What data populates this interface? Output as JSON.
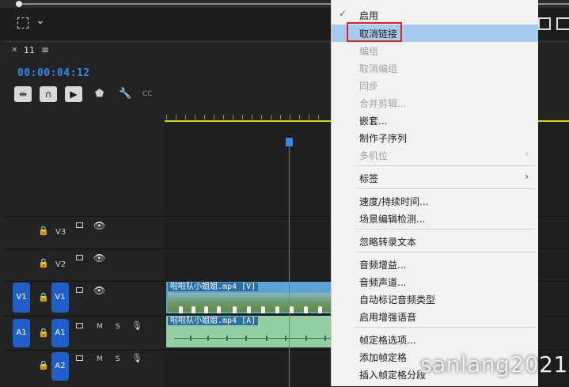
{
  "timeline": {
    "sequence_name": "11",
    "timecode": "00:00:04:12",
    "tracks": {
      "v3": "V3",
      "v2": "V2",
      "v1": "V1",
      "v1_source": "V1",
      "a1": "A1",
      "a1_source": "A1",
      "a2": "A2",
      "m_label": "M",
      "s_label": "S"
    },
    "video_clip_title": "啦啦队小姐姐.mp4 [V]",
    "audio_clip_title": "啦啦队小姐姐.mp4 [A]",
    "tool_cc": "CC"
  },
  "context_menu": {
    "items": [
      {
        "label": "启用",
        "checked": true,
        "disabled": false
      },
      {
        "label": "取消链接",
        "highlighted": true,
        "disabled": false
      },
      {
        "label": "编组",
        "disabled": true
      },
      {
        "label": "取消编组",
        "disabled": true
      },
      {
        "label": "同步",
        "disabled": true
      },
      {
        "label": "合并剪辑...",
        "disabled": true
      },
      {
        "label": "嵌套...",
        "disabled": false
      },
      {
        "label": "制作子序列",
        "disabled": false
      },
      {
        "label": "多机位",
        "disabled": true,
        "submenu": true
      },
      {
        "label": "标签",
        "disabled": false,
        "submenu": true
      },
      {
        "label": "速度/持续时间...",
        "disabled": false
      },
      {
        "label": "场景编辑检测...",
        "disabled": false
      },
      {
        "label": "忽略转录文本",
        "disabled": false
      },
      {
        "label": "音频增益...",
        "disabled": false
      },
      {
        "label": "音频声道...",
        "disabled": false
      },
      {
        "label": "自动标记音频类型",
        "disabled": false
      },
      {
        "label": "启用增强语音",
        "disabled": false
      },
      {
        "label": "帧定格选项...",
        "disabled": false
      },
      {
        "label": "添加帧定格",
        "disabled": false
      },
      {
        "label": "插入帧定格分段",
        "disabled": false
      }
    ],
    "highlight_color": "#a8ccf0",
    "annotation_color": "#e41d1d"
  },
  "watermark": "sanlang2021",
  "colors": {
    "accent": "#2d8ceb",
    "track_tag": "#1f5fc7",
    "video_clip": "#5aa5d3",
    "audio_clip": "#93cfa2"
  }
}
